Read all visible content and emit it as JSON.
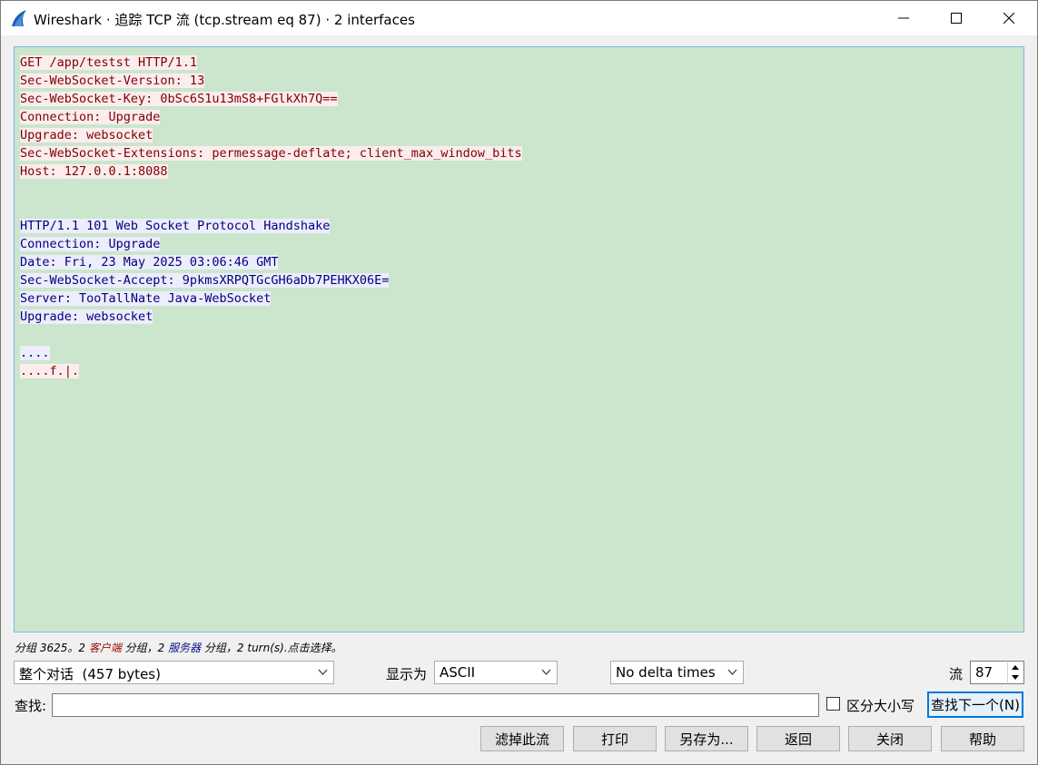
{
  "window": {
    "title": "Wireshark · 追踪 TCP 流 (tcp.stream eq 87) · 2 interfaces",
    "icon": "wireshark-fin-icon",
    "controls": [
      "minimize-icon",
      "maximize-icon",
      "close-icon"
    ]
  },
  "stream": {
    "lines": [
      {
        "side": "client",
        "text": "GET /app/testst HTTP/1.1"
      },
      {
        "side": "client",
        "text": "Sec-WebSocket-Version: 13"
      },
      {
        "side": "client",
        "text": "Sec-WebSocket-Key: 0bSc6S1u13mS8+FGlkXh7Q=="
      },
      {
        "side": "client",
        "text": "Connection: Upgrade"
      },
      {
        "side": "client",
        "text": "Upgrade: websocket"
      },
      {
        "side": "client",
        "text": "Sec-WebSocket-Extensions: permessage-deflate; client_max_window_bits"
      },
      {
        "side": "client",
        "text": "Host: 127.0.0.1:8088"
      },
      {
        "side": "none",
        "text": ""
      },
      {
        "side": "none",
        "text": ""
      },
      {
        "side": "server",
        "text": "HTTP/1.1 101 Web Socket Protocol Handshake"
      },
      {
        "side": "server",
        "text": "Connection: Upgrade"
      },
      {
        "side": "server",
        "text": "Date: Fri, 23 May 2025 03:06:46 GMT"
      },
      {
        "side": "server",
        "text": "Sec-WebSocket-Accept: 9pkmsXRPQTGcGH6aDb7PEHKX06E="
      },
      {
        "side": "server",
        "text": "Server: TooTallNate Java-WebSocket"
      },
      {
        "side": "server",
        "text": "Upgrade: websocket"
      },
      {
        "side": "none",
        "text": ""
      },
      {
        "side": "server",
        "text": "...."
      },
      {
        "side": "client",
        "text": "....f.|."
      }
    ],
    "colors": {
      "background": "#cbe6cd",
      "client_text": "#7f0000",
      "client_bg": "#fbeded",
      "server_text": "#00007f",
      "server_bg": "#ededfb"
    }
  },
  "status": {
    "prefix": "分组 3625。2 ",
    "client_label": "客户端",
    "middle": " 分组，2 ",
    "server_label": "服务器",
    "suffix": " 分组，2 turn(s).点击选择。"
  },
  "controls": {
    "conversation": "整个对话  (457 bytes)",
    "show_as_label": "显示为",
    "show_as": "ASCII",
    "delta": "No delta times",
    "stream_label": "流",
    "stream_value": "87"
  },
  "find": {
    "label": "查找:",
    "value": "",
    "case_label": "区分大小写",
    "case_checked": false,
    "find_next": "查找下一个(N)"
  },
  "buttons": {
    "filter_out": "滤掉此流",
    "print": "打印",
    "save_as": "另存为...",
    "back": "返回",
    "close": "关闭",
    "help": "帮助"
  }
}
